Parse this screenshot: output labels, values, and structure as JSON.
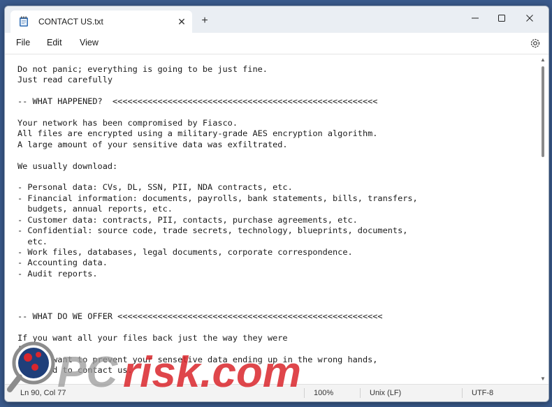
{
  "tab": {
    "title": "CONTACT US.txt",
    "close_glyph": "✕",
    "new_tab_glyph": "+"
  },
  "window_controls": {
    "minimize": "—",
    "maximize": "☐",
    "close": "✕"
  },
  "menu": {
    "file": "File",
    "edit": "Edit",
    "view": "View"
  },
  "editor": {
    "content": "Do not panic; everything is going to be just fine.\nJust read carefully\n\n-- WHAT HAPPENED?  <<<<<<<<<<<<<<<<<<<<<<<<<<<<<<<<<<<<<<<<<<<<<<<<<<<<<\n\nYour network has been compromised by Fiasco.\nAll files are encrypted using a military-grade AES encryption algorithm.\nA large amount of your sensitive data was exfiltrated.\n\nWe usually download:\n\n- Personal data: CVs, DL, SSN, PII, NDA contracts, etc.\n- Financial information: documents, payrolls, bank statements, bills, transfers,\n  budgets, annual reports, etc.\n- Customer data: contracts, PII, contacts, purchase agreements, etc.\n- Confidential: source code, trade secrets, technology, blueprints, documents,\n  etc.\n- Work files, databases, legal documents, corporate correspondence.\n- Accounting data.\n- Audit reports.\n\n\n\n-- WHAT DO WE OFFER <<<<<<<<<<<<<<<<<<<<<<<<<<<<<<<<<<<<<<<<<<<<<<<<<<<<<\n\nIf you want all your files back just the way they were\nA\nIf you want to prevent your sensetive data ending up in the wrong hands,\nyou need to contact us."
  },
  "scrollbar": {
    "up_glyph": "▲",
    "down_glyph": "▼"
  },
  "status": {
    "position": "Ln 90, Col 77",
    "zoom": "100%",
    "line_ending": "Unix (LF)",
    "encoding": "UTF-8"
  },
  "watermark": {
    "text": "risk.com",
    "prefix": "PC"
  },
  "colors": {
    "background": "#3a5a8c",
    "watermark_red": "#d9262c",
    "watermark_gray": "#9a9a9a"
  }
}
